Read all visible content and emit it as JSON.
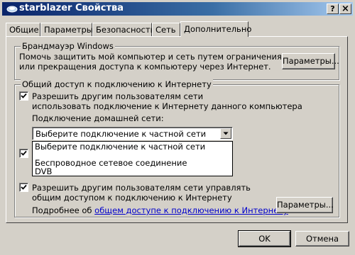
{
  "window": {
    "title": "starblazer Свойства",
    "help_label": "?",
    "close_label": "×"
  },
  "tabs": [
    {
      "label": "Общие"
    },
    {
      "label": "Параметры"
    },
    {
      "label": "Безопасность"
    },
    {
      "label": "Сеть"
    },
    {
      "label": "Дополнительно",
      "active": true
    }
  ],
  "firewall": {
    "legend": "Брандмауэр Windows",
    "line1": "Помочь защитить мой компьютер и сеть путем ограничения",
    "line2": "или прекращения доступа к компьютеру через Интернет.",
    "button": "Параметры..."
  },
  "ics": {
    "legend": "Общий доступ к подключению к Интернету",
    "allow_line1": "Разрешить другим пользователям сети",
    "allow_line2": "использовать подключение к Интернету данного компьютера",
    "allow_checked": true,
    "home_label": "Подключение домашней сети:",
    "combo_value": "Выберите подключение к частной сети",
    "options": [
      "Выберите подключение к частной сети",
      "",
      "Беспроводное сетевое соединение",
      "DVB"
    ],
    "second_checked": true,
    "manage_line1": "Разрешить другим пользователям сети управлять",
    "manage_line2": "общим доступом к подключению к Интернету",
    "manage_checked": true,
    "more_prefix": "Подробнее об ",
    "more_link": "общем доступе к подключению к Интернету",
    "more_suffix": ".",
    "button": "Параметры..."
  },
  "footer": {
    "ok": "OK",
    "cancel": "Отмена"
  }
}
